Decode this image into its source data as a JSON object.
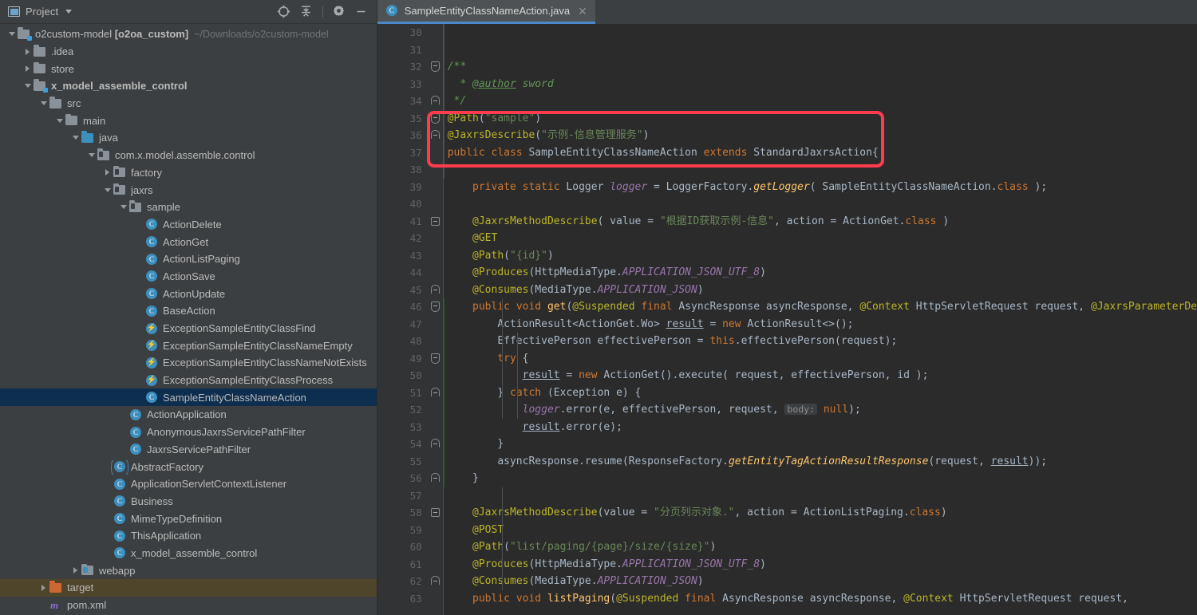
{
  "project_panel": {
    "title": "Project",
    "caret_icon": "chevron-down-icon",
    "panel_icon": "project-view-icon",
    "actions": [
      {
        "name": "locate-icon",
        "glyph": "target"
      },
      {
        "name": "collapse-all-icon",
        "glyph": "collapse"
      },
      {
        "name": "gear-icon",
        "glyph": "gear"
      },
      {
        "name": "hide-icon",
        "glyph": "minus"
      }
    ],
    "tree": [
      {
        "indent": 0,
        "arrow": "down",
        "icon": "module-folder",
        "label": "o2custom-model [o2oa_custom]",
        "bold_part": "[o2oa_custom]",
        "path": "~/Downloads/o2custom-model",
        "state": "normal"
      },
      {
        "indent": 1,
        "arrow": "right",
        "icon": "folder-grey",
        "label": ".idea",
        "state": "normal"
      },
      {
        "indent": 1,
        "arrow": "right",
        "icon": "folder-grey",
        "label": "store",
        "state": "normal"
      },
      {
        "indent": 1,
        "arrow": "down",
        "icon": "module-folder",
        "label": "x_model_assemble_control",
        "bold": true,
        "state": "normal"
      },
      {
        "indent": 2,
        "arrow": "down",
        "icon": "folder-grey",
        "label": "src",
        "state": "normal"
      },
      {
        "indent": 3,
        "arrow": "down",
        "icon": "folder-grey",
        "label": "main",
        "state": "normal"
      },
      {
        "indent": 4,
        "arrow": "down",
        "icon": "folder-source",
        "label": "java",
        "state": "normal"
      },
      {
        "indent": 5,
        "arrow": "down",
        "icon": "folder-package",
        "label": "com.x.model.assemble.control",
        "state": "normal"
      },
      {
        "indent": 6,
        "arrow": "right",
        "icon": "folder-package",
        "label": "factory",
        "state": "normal"
      },
      {
        "indent": 6,
        "arrow": "down",
        "icon": "folder-package",
        "label": "jaxrs",
        "state": "normal"
      },
      {
        "indent": 7,
        "arrow": "down",
        "icon": "folder-package",
        "label": "sample",
        "state": "normal"
      },
      {
        "indent": 8,
        "arrow": "none",
        "icon": "java-class",
        "label": "ActionDelete",
        "state": "normal"
      },
      {
        "indent": 8,
        "arrow": "none",
        "icon": "java-class",
        "label": "ActionGet",
        "state": "normal"
      },
      {
        "indent": 8,
        "arrow": "none",
        "icon": "java-class",
        "label": "ActionListPaging",
        "state": "normal"
      },
      {
        "indent": 8,
        "arrow": "none",
        "icon": "java-class",
        "label": "ActionSave",
        "state": "normal"
      },
      {
        "indent": 8,
        "arrow": "none",
        "icon": "java-class",
        "label": "ActionUpdate",
        "state": "normal"
      },
      {
        "indent": 8,
        "arrow": "none",
        "icon": "java-class",
        "label": "BaseAction",
        "state": "normal"
      },
      {
        "indent": 8,
        "arrow": "none",
        "icon": "java-exception",
        "label": "ExceptionSampleEntityClassFind",
        "state": "normal"
      },
      {
        "indent": 8,
        "arrow": "none",
        "icon": "java-exception",
        "label": "ExceptionSampleEntityClassNameEmpty",
        "state": "normal"
      },
      {
        "indent": 8,
        "arrow": "none",
        "icon": "java-exception",
        "label": "ExceptionSampleEntityClassNameNotExists",
        "state": "normal"
      },
      {
        "indent": 8,
        "arrow": "none",
        "icon": "java-exception",
        "label": "ExceptionSampleEntityClassProcess",
        "state": "normal"
      },
      {
        "indent": 8,
        "arrow": "none",
        "icon": "java-class",
        "label": "SampleEntityClassNameAction",
        "state": "selected"
      },
      {
        "indent": 7,
        "arrow": "none",
        "icon": "java-class",
        "label": "ActionApplication",
        "state": "normal"
      },
      {
        "indent": 7,
        "arrow": "none",
        "icon": "java-class",
        "label": "AnonymousJaxrsServicePathFilter",
        "state": "normal"
      },
      {
        "indent": 7,
        "arrow": "none",
        "icon": "java-class",
        "label": "JaxrsServicePathFilter",
        "state": "normal"
      },
      {
        "indent": 6,
        "arrow": "none",
        "icon": "java-abstract",
        "label": "AbstractFactory",
        "state": "normal"
      },
      {
        "indent": 6,
        "arrow": "none",
        "icon": "java-class",
        "label": "ApplicationServletContextListener",
        "state": "normal"
      },
      {
        "indent": 6,
        "arrow": "none",
        "icon": "java-class",
        "label": "Business",
        "state": "normal"
      },
      {
        "indent": 6,
        "arrow": "none",
        "icon": "java-class",
        "label": "MimeTypeDefinition",
        "state": "normal"
      },
      {
        "indent": 6,
        "arrow": "none",
        "icon": "java-class",
        "label": "ThisApplication",
        "state": "normal"
      },
      {
        "indent": 6,
        "arrow": "none",
        "icon": "java-class",
        "label": "x_model_assemble_control",
        "state": "normal"
      },
      {
        "indent": 4,
        "arrow": "right",
        "icon": "folder-web",
        "label": "webapp",
        "state": "normal"
      },
      {
        "indent": 2,
        "arrow": "right",
        "icon": "folder-orange",
        "label": "target",
        "state": "highlight"
      },
      {
        "indent": 2,
        "arrow": "none",
        "icon": "maven-file",
        "label": "pom.xml",
        "state": "normal"
      }
    ]
  },
  "editor": {
    "tab": {
      "label": "SampleEntityClassNameAction.java",
      "icon": "java-class",
      "close_icon": "close-icon"
    },
    "first_line_number": 30,
    "lines": [
      {
        "n": 30,
        "fold": "",
        "html": ""
      },
      {
        "n": 31,
        "fold": "",
        "html": ""
      },
      {
        "n": 32,
        "fold": "start",
        "html": "<span class=\"cmt\">/**</span>"
      },
      {
        "n": 33,
        "fold": "",
        "html": "<span class=\"cmt\">  * <u>@author</u> sword</span>"
      },
      {
        "n": 34,
        "fold": "end",
        "html": "<span class=\"cmt\"> */</span>"
      },
      {
        "n": 35,
        "fold": "start",
        "html": "<span class=\"ann\">@Path</span><span class=\"op\">(</span><span class=\"str\">\"sample\"</span><span class=\"op\">)</span>"
      },
      {
        "n": 36,
        "fold": "end",
        "html": "<span class=\"ann\">@JaxrsDescribe</span><span class=\"op\">(</span><span class=\"str\">\"示例-信息管理服务\"</span><span class=\"op\">)</span>"
      },
      {
        "n": 37,
        "fold": "",
        "html": "<span class=\"kw\">public class</span> SampleEntityClassNameAction <span class=\"kw\">extends</span> StandardJaxrsAction{"
      },
      {
        "n": 38,
        "fold": "",
        "html": ""
      },
      {
        "n": 39,
        "fold": "",
        "html": "    <span class=\"kw\">private static</span> Logger <span class=\"fld\">logger</span> <span class=\"op\">=</span> LoggerFactory.<span class=\"mth stat\">getLogger</span><span class=\"op\">(</span> SampleEntityClassNameAction.<span class=\"kw\">class</span> <span class=\"op\">)</span><span class=\"op\">;</span>"
      },
      {
        "n": 40,
        "fold": "",
        "html": ""
      },
      {
        "n": 41,
        "fold": "minus",
        "html": "    <span class=\"ann\">@JaxrsMethodDescribe</span><span class=\"op\">(</span> value <span class=\"op\">=</span> <span class=\"str\">\"根据ID获取示例-信息\"</span><span class=\"op\">,</span> action <span class=\"op\">=</span> ActionGet.<span class=\"kw\">class</span> <span class=\"op\">)</span>"
      },
      {
        "n": 42,
        "fold": "",
        "html": "    <span class=\"ann\">@GET</span>"
      },
      {
        "n": 43,
        "fold": "",
        "html": "    <span class=\"ann\">@Path</span><span class=\"op\">(</span><span class=\"str\">\"{id}\"</span><span class=\"op\">)</span>"
      },
      {
        "n": 44,
        "fold": "",
        "html": "    <span class=\"ann\">@Produces</span><span class=\"op\">(</span>HttpMediaType.<span class=\"const\">APPLICATION_JSON_UTF_8</span><span class=\"op\">)</span>"
      },
      {
        "n": 45,
        "fold": "end",
        "html": "    <span class=\"ann\">@Consumes</span><span class=\"op\">(</span>MediaType.<span class=\"const\">APPLICATION_JSON</span><span class=\"op\">)</span>"
      },
      {
        "n": 46,
        "fold": "start",
        "html": "    <span class=\"kw\">public void</span> <span class=\"mth\">get</span><span class=\"op\">(</span><span class=\"ann\">@Suspended</span> <span class=\"kw\">final</span> AsyncResponse asyncResponse<span class=\"op\">,</span> <span class=\"ann\">@Context</span> HttpServletRequest request<span class=\"op\">,</span> <span class=\"ann\">@JaxrsParameterDe</span>"
      },
      {
        "n": 47,
        "fold": "",
        "html": "        ActionResult&lt;ActionGet.Wo&gt; <span class=\"ul\">result</span> <span class=\"op\">=</span> <span class=\"kw\">new</span> ActionResult<span class=\"op\">&lt;&gt;()</span><span class=\"op\">;</span>"
      },
      {
        "n": 48,
        "fold": "",
        "html": "        EffectivePerson effectivePerson <span class=\"op\">=</span> <span class=\"kw\">this</span>.effectivePerson<span class=\"op\">(</span>request<span class=\"op\">)</span><span class=\"op\">;</span>"
      },
      {
        "n": 49,
        "fold": "start",
        "html": "        <span class=\"kw\">try</span> {"
      },
      {
        "n": 50,
        "fold": "",
        "html": "            <span class=\"ul\">result</span> <span class=\"op\">=</span> <span class=\"kw\">new</span> ActionGet<span class=\"op\">()</span>.execute<span class=\"op\">(</span> request<span class=\"op\">,</span> effectivePerson<span class=\"op\">,</span> id <span class=\"op\">)</span><span class=\"op\">;</span>"
      },
      {
        "n": 51,
        "fold": "end",
        "html": "        } <span class=\"kw\">catch</span> <span class=\"op\">(</span>Exception e<span class=\"op\">)</span> {"
      },
      {
        "n": 52,
        "fold": "",
        "html": "            <span class=\"fld\">logger</span>.error<span class=\"op\">(</span>e<span class=\"op\">,</span> effectivePerson<span class=\"op\">,</span> request<span class=\"op\">,</span> <span class=\"hint\">body:</span> <span class=\"kw\">null</span><span class=\"op\">)</span><span class=\"op\">;</span>"
      },
      {
        "n": 53,
        "fold": "",
        "html": "            <span class=\"ul\">result</span>.error<span class=\"op\">(</span>e<span class=\"op\">)</span><span class=\"op\">;</span>"
      },
      {
        "n": 54,
        "fold": "end",
        "html": "        }"
      },
      {
        "n": 55,
        "fold": "",
        "html": "        asyncResponse.resume<span class=\"op\">(</span>ResponseFactory.<span class=\"mth stat\">getEntityTagActionResultResponse</span><span class=\"op\">(</span>request<span class=\"op\">,</span> <span class=\"ul\">result</span><span class=\"op\">))</span><span class=\"op\">;</span>"
      },
      {
        "n": 56,
        "fold": "end",
        "html": "    }"
      },
      {
        "n": 57,
        "fold": "",
        "html": ""
      },
      {
        "n": 58,
        "fold": "minus",
        "html": "    <span class=\"ann\">@JaxrsMethodDescribe</span><span class=\"op\">(</span>value <span class=\"op\">=</span> <span class=\"str\">\"分页列示对象.\"</span><span class=\"op\">,</span> action <span class=\"op\">=</span> ActionListPaging.<span class=\"kw\">class</span><span class=\"op\">)</span>"
      },
      {
        "n": 59,
        "fold": "",
        "html": "    <span class=\"ann\">@POST</span>"
      },
      {
        "n": 60,
        "fold": "",
        "html": "    <span class=\"ann\">@Path</span><span class=\"op\">(</span><span class=\"str\">\"list/paging/{page}/size/{size}\"</span><span class=\"op\">)</span>"
      },
      {
        "n": 61,
        "fold": "",
        "html": "    <span class=\"ann\">@Produces</span><span class=\"op\">(</span>HttpMediaType.<span class=\"const\">APPLICATION_JSON_UTF_8</span><span class=\"op\">)</span>"
      },
      {
        "n": 62,
        "fold": "end",
        "html": "    <span class=\"ann\">@Consumes</span><span class=\"op\">(</span>MediaType.<span class=\"const\">APPLICATION_JSON</span><span class=\"op\">)</span>"
      },
      {
        "n": 63,
        "fold": "",
        "html": "    <span class=\"kw\">public void</span> <span class=\"mth\">listPaging</span><span class=\"op\">(</span><span class=\"ann\">@Suspended</span> <span class=\"kw\">final</span> AsyncResponse asyncResponse<span class=\"op\">,</span> <span class=\"ann\">@Context</span> HttpServletRequest request<span class=\"op\">,</span>"
      }
    ],
    "annotation": {
      "name": "red-highlight-box",
      "color": "#ff3b4e",
      "covers_lines": [
        35,
        36,
        37
      ]
    }
  },
  "colors": {
    "panel_bg": "#3c3f41",
    "editor_bg": "#2b2b2b",
    "gutter_bg": "#313335",
    "selection": "#0d2e4f",
    "highlight_row": "#4f452b",
    "tab_active_underline": "#4a88c7",
    "annotation": "#ff3b4e"
  }
}
